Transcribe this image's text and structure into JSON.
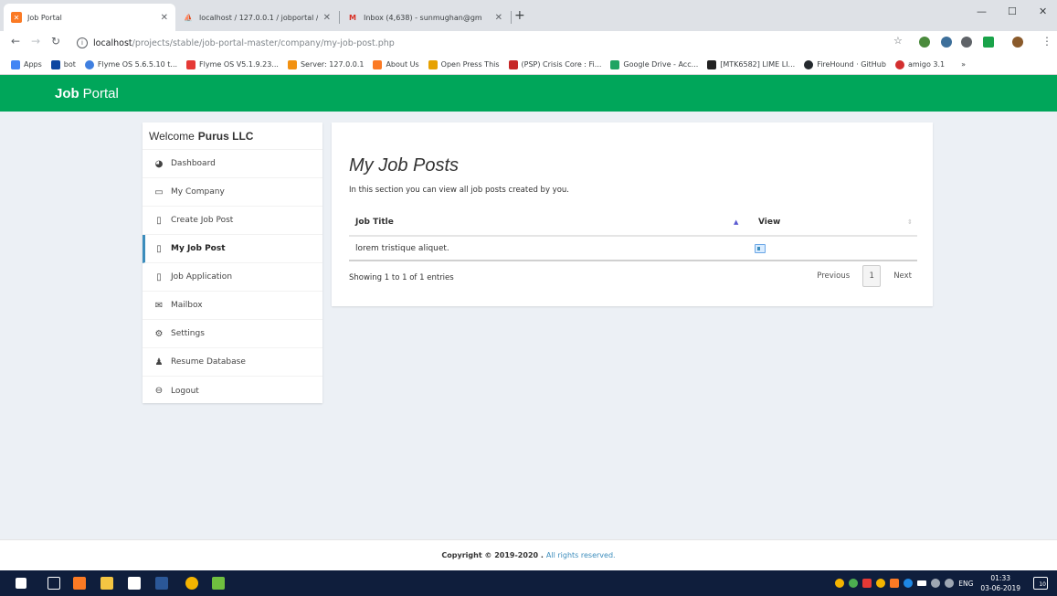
{
  "browser": {
    "tabs": [
      {
        "label": "Job Portal",
        "active": true
      },
      {
        "label": "localhost / 127.0.0.1 / jobportal /",
        "active": false
      },
      {
        "label": "Inbox (4,638) - sunmughan@gm",
        "active": false
      }
    ],
    "url_host": "localhost",
    "url_path": "/projects/stable/job-portal-master/company/my-job-post.php",
    "bookmarks": [
      "Apps",
      "bot",
      "Flyme OS 5.6.5.10 t...",
      "Flyme OS V5.1.9.23...",
      "Server: 127.0.0.1",
      "About Us",
      "Open Press This",
      "(PSP) Crisis Core : Fi...",
      "Google Drive - Acc...",
      "[MTK6582] LIME LI...",
      "FireHound · GitHub",
      "amigo 3.1"
    ],
    "bookmarks_more": "»"
  },
  "header": {
    "brand_bold": "Job",
    "brand_rest": "Portal"
  },
  "sidebar": {
    "welcome": "Welcome",
    "company": "Purus LLC",
    "items": [
      {
        "label": "Dashboard"
      },
      {
        "label": "My Company"
      },
      {
        "label": "Create Job Post"
      },
      {
        "label": "My Job Post"
      },
      {
        "label": "Job Application"
      },
      {
        "label": "Mailbox"
      },
      {
        "label": "Settings"
      },
      {
        "label": "Resume Database"
      },
      {
        "label": "Logout"
      }
    ]
  },
  "main": {
    "title": "My Job Posts",
    "description": "In this section you can view all job posts created by you.",
    "columns": {
      "title": "Job Title",
      "view": "View"
    },
    "rows": [
      {
        "title": "lorem tristique aliquet."
      }
    ],
    "info": "Showing 1 to 1 of 1 entries",
    "pagination": {
      "previous": "Previous",
      "page": "1",
      "next": "Next"
    }
  },
  "footer": {
    "copyright": "Copyright © 2019-2020 .",
    "rights": "All rights reserved."
  },
  "taskbar": {
    "lang": "ENG",
    "time": "01:33",
    "date": "03-06-2019",
    "notifications": "10"
  },
  "colors": {
    "header": "#00a65a",
    "active_border": "#3c8dbc"
  }
}
